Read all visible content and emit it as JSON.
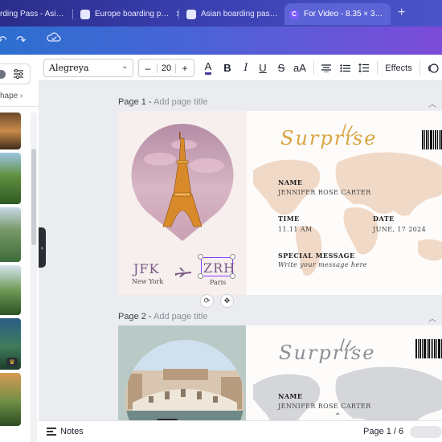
{
  "browser": {
    "tabs": [
      {
        "title": "rding Pass - Asi…",
        "active": false
      },
      {
        "title": "Europe boarding p…",
        "active": false
      },
      {
        "title": "Asian boarding pas…",
        "active": false
      },
      {
        "title": "For Video - 8.35 × 3…",
        "active": true
      }
    ],
    "new_tab_symbol": "+",
    "favicon_letter": "C"
  },
  "app_bar": {
    "icons": [
      "redo-icon",
      "cloud-save-icon"
    ]
  },
  "left_panel": {
    "breadcrumb": "hape",
    "breadcrumb_arrow": "›",
    "collapse_symbol": "‹",
    "premium_badge": "♛"
  },
  "toolbar": {
    "font_name": "Alegreya",
    "font_caret": "⌄",
    "font_size": "20",
    "minus": "–",
    "plus": "+",
    "text_color_glyph": "A",
    "bold": "B",
    "italic": "I",
    "underline": "U",
    "strikethrough": "S",
    "case": "aA",
    "effects_label": "Effects"
  },
  "pages": [
    {
      "label": "Page 1 -",
      "placeholder": "Add page title",
      "surprise": "Surprise",
      "name_label": "NAME",
      "name_value": "JENNIFER ROSE CARTER",
      "time_label": "TIME",
      "time_value": "11.11 AM",
      "date_label": "DATE",
      "date_value": "JUNE, 17 2024",
      "special_label": "SPECIAL MESSAGE",
      "special_value": "Write your message here",
      "from_code": "JFK",
      "from_city": "New York",
      "to_code": "ZRH",
      "to_city": "Paris"
    },
    {
      "label": "Page 2 -",
      "placeholder": "Add page title",
      "surprise": "Surprise",
      "name_label": "NAME",
      "name_value": "JENNIFER ROSE CARTER"
    }
  ],
  "bottom_bar": {
    "notes_label": "Notes",
    "pager": "Page 1 / 6",
    "scroll_hint": "⌃"
  },
  "colors": {
    "accent": "#8b3dff",
    "surprise_gold": "#d9a441",
    "route_plum": "#7b5a86",
    "map_peach": "#f1d9c7",
    "map_grey": "#d4d6da"
  }
}
